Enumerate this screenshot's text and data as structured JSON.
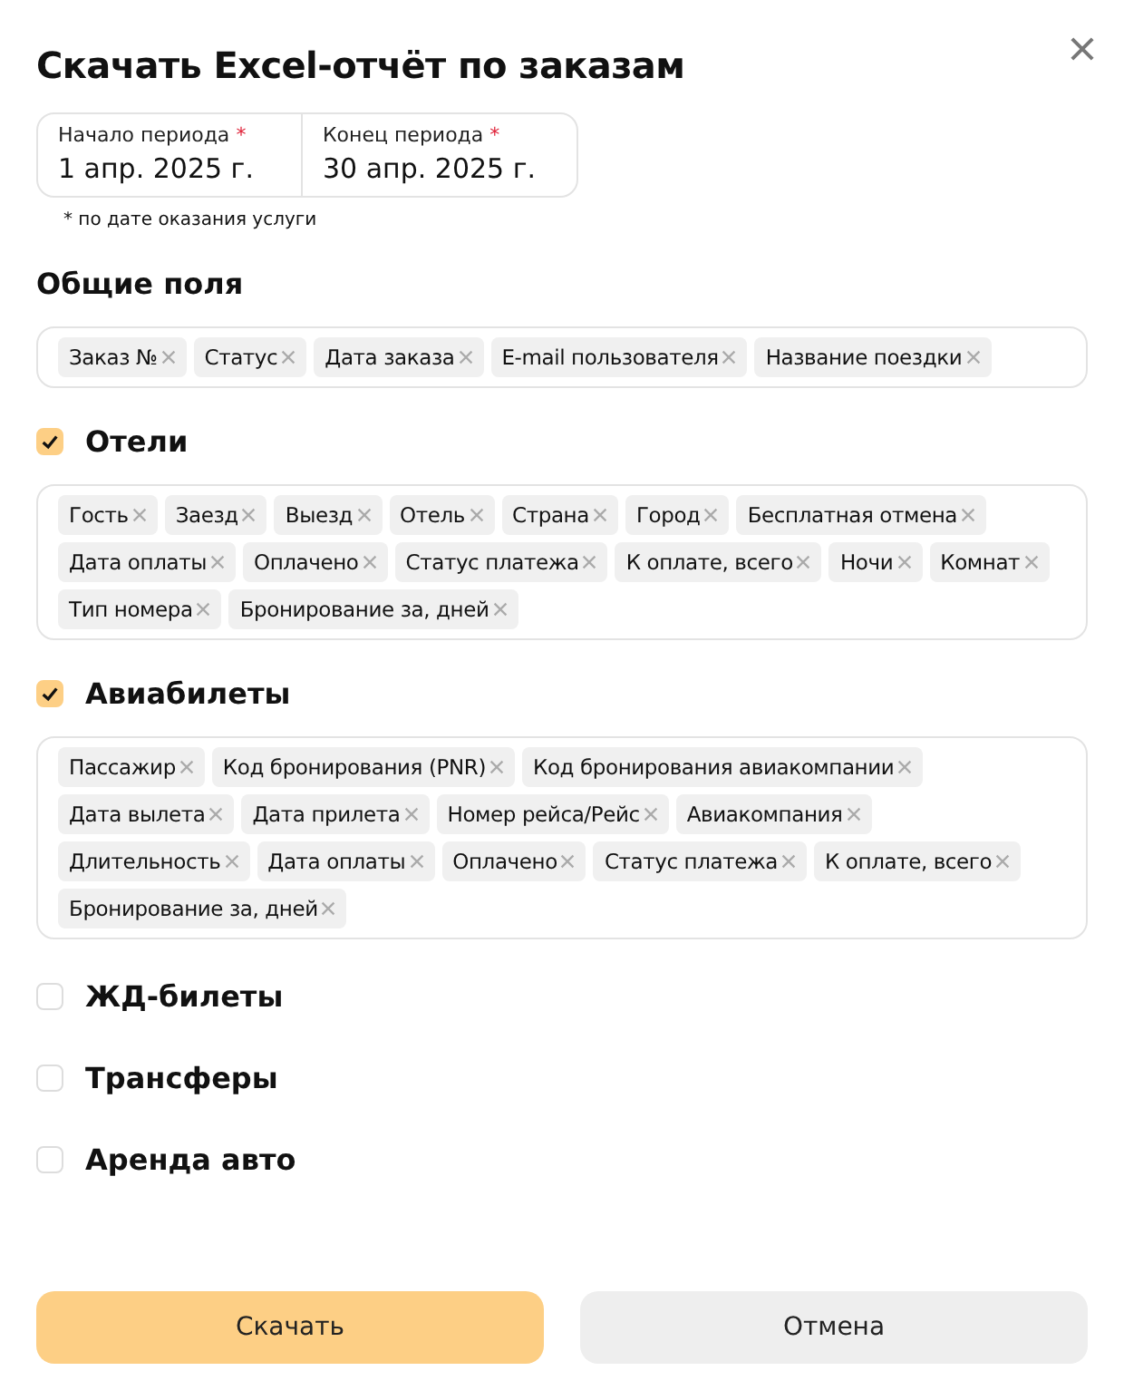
{
  "dialog": {
    "title": "Скачать Excel-отчёт по заказам"
  },
  "period": {
    "fields": [
      {
        "label": "Начало периода",
        "required_mark": "*",
        "value": "1 апр. 2025 г."
      },
      {
        "label": "Конец периода",
        "required_mark": "*",
        "value": "30 апр. 2025 г."
      }
    ],
    "note": "* по дате оказания услуги"
  },
  "sections": [
    {
      "kind": "plain",
      "title": "Общие поля",
      "tags": [
        "Заказ №",
        "Статус",
        "Дата заказа",
        "E-mail пользователя",
        "Название поездки"
      ]
    },
    {
      "kind": "checkbox",
      "title": "Отели",
      "checked": true,
      "tags": [
        "Гость",
        "Заезд",
        "Выезд",
        "Отель",
        "Страна",
        "Город",
        "Бесплатная отмена",
        "Дата оплаты",
        "Оплачено",
        "Статус платежа",
        "К оплате, всего",
        "Ночи",
        "Комнат",
        "Тип номера",
        "Бронирование за, дней"
      ]
    },
    {
      "kind": "checkbox",
      "title": "Авиабилеты",
      "checked": true,
      "tags": [
        "Пассажир",
        "Код бронирования (PNR)",
        "Код бронирования авиакомпании",
        "Дата вылета",
        "Дата прилета",
        "Номер рейса/Рейс",
        "Авиакомпания",
        "Длительность",
        "Дата оплаты",
        "Оплачено",
        "Статус платежа",
        "К оплате, всего",
        "Бронирование за, дней"
      ]
    },
    {
      "kind": "checkbox",
      "title": "ЖД-билеты",
      "checked": false
    },
    {
      "kind": "checkbox",
      "title": "Трансферы",
      "checked": false
    },
    {
      "kind": "checkbox",
      "title": "Аренда авто",
      "checked": false
    }
  ],
  "buttons": [
    {
      "kind": "primary",
      "label": "Скачать"
    },
    {
      "kind": "secondary",
      "label": "Отмена"
    }
  ]
}
